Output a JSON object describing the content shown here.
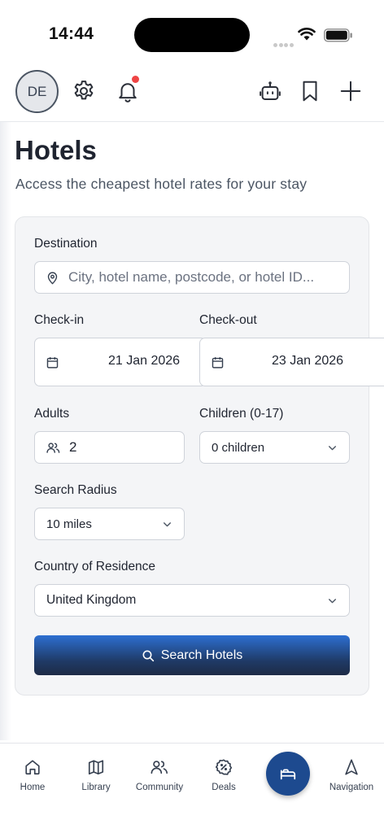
{
  "status_bar": {
    "time": "14:44"
  },
  "header": {
    "avatar_initials": "DE",
    "icons": [
      "gear-icon",
      "bell-icon",
      "robot-icon",
      "bookmark-icon",
      "plus-icon"
    ],
    "notification_color": "#ef4444"
  },
  "page": {
    "title": "Hotels",
    "subtitle": "Access the cheapest hotel rates for your stay"
  },
  "form": {
    "destination": {
      "label": "Destination",
      "placeholder": "City, hotel name, postcode, or hotel ID..."
    },
    "check_in": {
      "label": "Check-in",
      "value": "21 Jan 2026"
    },
    "check_out": {
      "label": "Check-out",
      "value": "23 Jan 2026"
    },
    "adults": {
      "label": "Adults",
      "value": "2"
    },
    "children": {
      "label": "Children (0-17)",
      "value": "0 children"
    },
    "radius": {
      "label": "Search Radius",
      "value": "10 miles"
    },
    "country": {
      "label": "Country of Residence",
      "value": "United Kingdom"
    },
    "submit_label": "Search Hotels"
  },
  "bottom_nav": {
    "items": [
      {
        "label": "Home",
        "icon": "home-icon"
      },
      {
        "label": "Library",
        "icon": "map-icon"
      },
      {
        "label": "Community",
        "icon": "users-icon"
      },
      {
        "label": "Deals",
        "icon": "percent-badge-icon"
      },
      {
        "label": "",
        "icon": "bed-icon"
      },
      {
        "label": "Navigation",
        "icon": "navigation-arrow-icon"
      }
    ]
  },
  "colors": {
    "accent": "#1d4a8f",
    "button_top": "#2d6fd1",
    "button_bottom": "#1e2b46"
  }
}
